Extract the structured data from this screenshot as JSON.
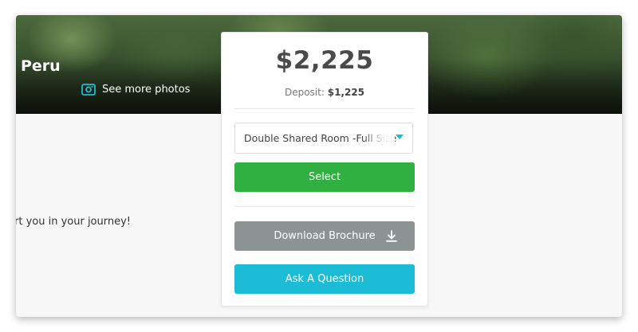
{
  "hero": {
    "title": "Peru",
    "photos_label": "See more photos"
  },
  "body": {
    "text_fragment": "rt you in your journey!"
  },
  "booking": {
    "price": "$2,225",
    "deposit_label": "Deposit:",
    "deposit_value": "$1,225",
    "room_select": {
      "selected": "Double Shared Room -Full Size"
    },
    "select_label": "Select",
    "brochure_label": "Download Brochure",
    "question_label": "Ask A Question"
  },
  "colors": {
    "select_button": "#31b042",
    "brochure_button": "#8d9393",
    "question_button": "#1cbcd6",
    "accent": "#1bbcd6"
  },
  "icons": [
    "camera-icon",
    "chevron-down-icon",
    "download-icon"
  ]
}
